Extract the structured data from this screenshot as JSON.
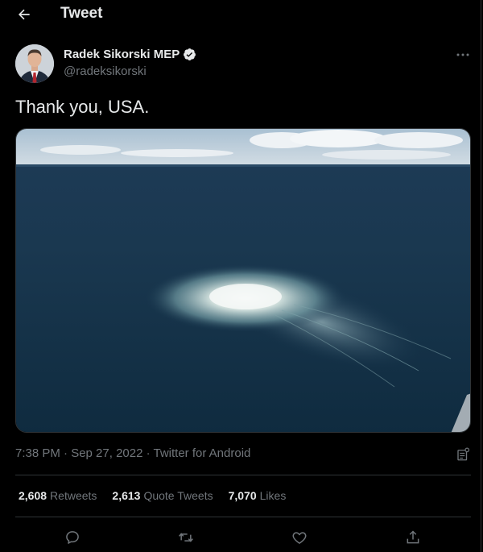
{
  "header": {
    "title": "Tweet",
    "back_icon": "arrow-left-icon"
  },
  "author": {
    "name": "Radek Sikorski MEP",
    "handle": "@radeksikorski",
    "verified_icon": "verified-badge-icon",
    "more_icon": "more-horizontal-icon"
  },
  "tweet": {
    "text": "Thank you, USA.",
    "media_description_icon": "photo"
  },
  "meta": {
    "line": "7:38 PM · Sep 27, 2022 · Twitter for Android",
    "analytics_icon": "analytics-icon"
  },
  "stats": {
    "retweets_count": "2,608",
    "retweets_label": "Retweets",
    "quotes_count": "2,613",
    "quotes_label": "Quote Tweets",
    "likes_count": "7,070",
    "likes_label": "Likes"
  },
  "actions": {
    "reply_icon": "reply-icon",
    "retweet_icon": "retweet-icon",
    "like_icon": "heart-icon",
    "share_icon": "share-icon"
  },
  "colors": {
    "background": "#000000",
    "text_primary": "#e7e9ea",
    "text_secondary": "#71767b",
    "divider": "#2f3336"
  }
}
